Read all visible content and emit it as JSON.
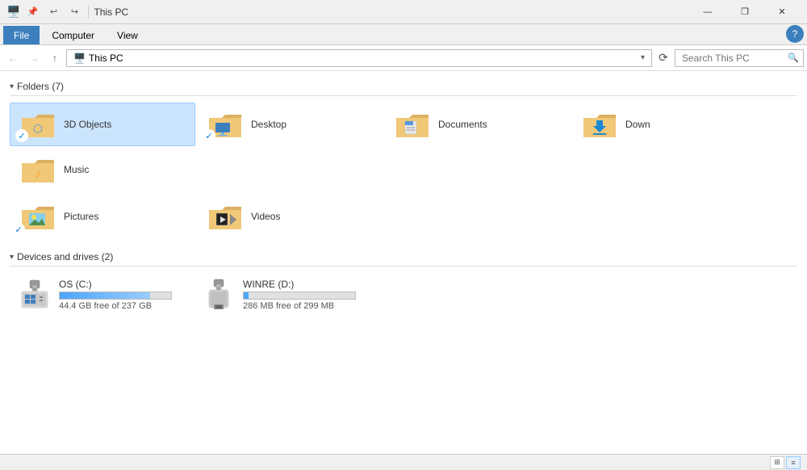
{
  "window": {
    "title": "This PC",
    "icon": "🖥️"
  },
  "titlebar": {
    "title": "This PC",
    "min_label": "—",
    "max_label": "❐",
    "close_label": "✕"
  },
  "quickaccess": {
    "pin_label": "📌",
    "undo_label": "↩",
    "redo_label": "↪"
  },
  "ribbon": {
    "tabs": [
      "File",
      "Computer",
      "View"
    ]
  },
  "addressbar": {
    "back_label": "←",
    "forward_label": "→",
    "up_label": "↑",
    "path": "This PC",
    "refresh_label": "⟳",
    "search_placeholder": "Search This PC"
  },
  "sections": {
    "folders": {
      "label": "Folders (7)",
      "items": [
        {
          "name": "3D Objects",
          "type": "3d",
          "checked": true
        },
        {
          "name": "Desktop",
          "type": "desktop",
          "checked": true
        },
        {
          "name": "Documents",
          "type": "documents",
          "checked": false
        },
        {
          "name": "Down",
          "type": "download",
          "checked": false
        },
        {
          "name": "Music",
          "type": "music",
          "checked": false
        },
        {
          "name": "Pictures",
          "type": "pictures",
          "checked": true
        },
        {
          "name": "Videos",
          "type": "videos",
          "checked": false
        }
      ]
    },
    "drives": {
      "label": "Devices and drives (2)",
      "items": [
        {
          "name": "OS (C:)",
          "type": "os",
          "free": "44.4 GB free of 237 GB",
          "used_pct": 81
        },
        {
          "name": "WINRE (D:)",
          "type": "usb",
          "free": "286 MB free of 299 MB",
          "used_pct": 4
        }
      ]
    }
  },
  "statusbar": {
    "view_tiles_label": "⊞",
    "view_list_label": "≡"
  }
}
